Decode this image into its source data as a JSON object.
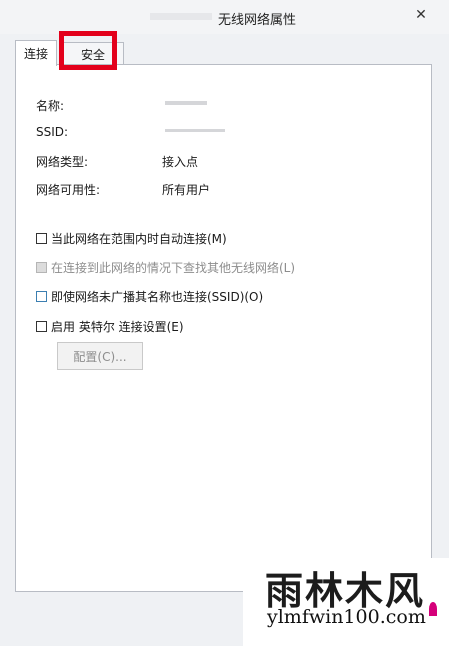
{
  "window": {
    "title": "无线网络属性",
    "close_glyph": "✕"
  },
  "tabs": {
    "connection": "连接",
    "security": "安全"
  },
  "info": {
    "name_label": "名称:",
    "ssid_label": "SSID:",
    "network_type_label": "网络类型:",
    "network_type_value": "接入点",
    "availability_label": "网络可用性:",
    "availability_value": "所有用户"
  },
  "options": {
    "auto_connect": "当此网络在范围内时自动连接(M)",
    "look_for_other": "在连接到此网络的情况下查找其他无线网络(L)",
    "connect_hidden": "即使网络未广播其名称也连接(SSID)(O)",
    "intel_settings": "启用 英特尔 连接设置(E)"
  },
  "buttons": {
    "configure": "配置(C)..."
  },
  "watermark": {
    "logo_text": "雨林木风",
    "url": "ylmfwin100.com"
  },
  "icons": {
    "close": "close-icon",
    "checkbox": "checkbox"
  },
  "colors": {
    "highlight": "#e3001b",
    "focus_border": "#3c7fb1"
  }
}
